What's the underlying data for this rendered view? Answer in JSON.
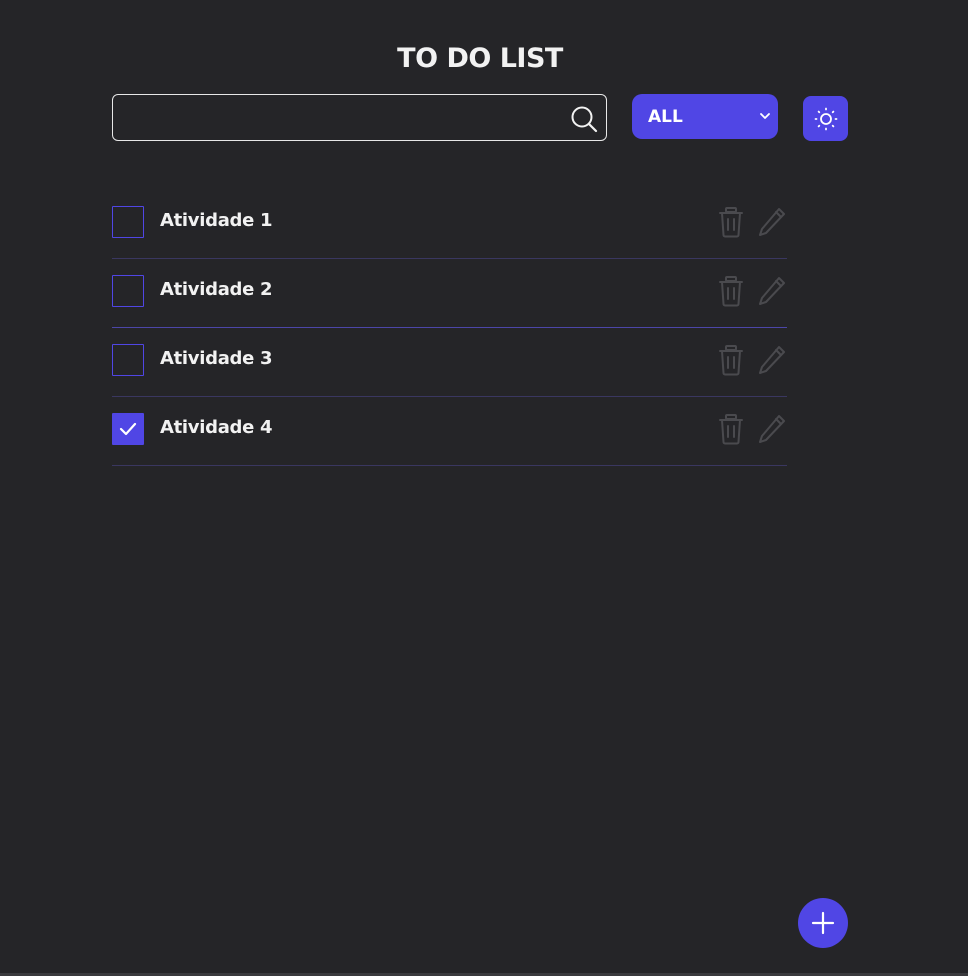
{
  "header": {
    "title": "TO DO LIST"
  },
  "search": {
    "value": "",
    "placeholder": "",
    "icon": "search-icon"
  },
  "filter": {
    "selected": "ALL",
    "icon": "chevron-down-icon"
  },
  "theme_toggle": {
    "icon": "sun-icon"
  },
  "todos": [
    {
      "label": "Atividade 1",
      "checked": false
    },
    {
      "label": "Atividade 2",
      "checked": false
    },
    {
      "label": "Atividade 3",
      "checked": false
    },
    {
      "label": "Atividade 4",
      "checked": true
    }
  ],
  "row_actions": {
    "delete_icon": "trash-icon",
    "edit_icon": "pencil-icon"
  },
  "add_button": {
    "icon": "plus-icon"
  },
  "colors": {
    "background": "#252528",
    "accent": "#5046e5",
    "text": "#f2f2f2",
    "muted_icon": "#4a4a4e",
    "divider": "#3a3760"
  }
}
